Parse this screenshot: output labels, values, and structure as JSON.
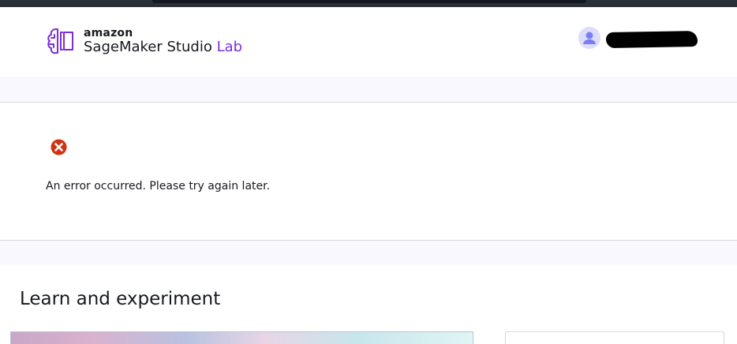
{
  "header": {
    "brand_amazon": "amazon",
    "brand_product": "SageMaker Studio",
    "brand_accent": "Lab",
    "logo_icon": "sagemaker-brain-icon",
    "avatar_icon": "user-avatar-icon",
    "accent_color": "#7d2dd9"
  },
  "error": {
    "icon": "error-x-icon",
    "message": "An error occurred. Please try again later.",
    "color": "#d13212"
  },
  "main": {
    "section_title": "Learn and experiment"
  }
}
